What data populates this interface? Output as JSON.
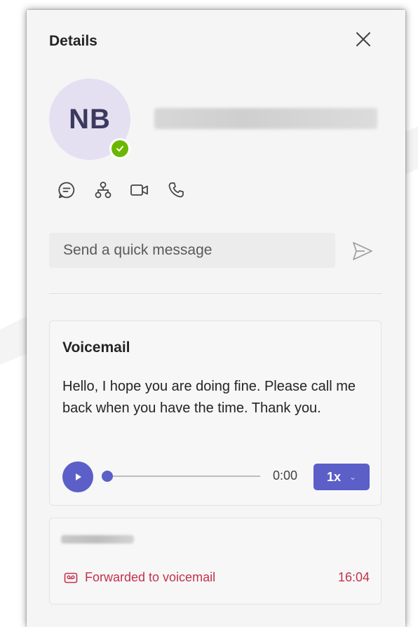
{
  "header": {
    "title": "Details",
    "close_icon": "close-icon"
  },
  "contact": {
    "initials": "NB",
    "presence_color": "#6bb700",
    "presence_icon": "check-icon"
  },
  "actions": [
    {
      "icon": "chat-icon"
    },
    {
      "icon": "org-chart-icon"
    },
    {
      "icon": "video-call-icon"
    },
    {
      "icon": "phone-icon"
    }
  ],
  "quick_message": {
    "placeholder": "Send a quick message",
    "value": "",
    "send_icon": "send-icon"
  },
  "voicemail": {
    "title": "Voicemail",
    "transcript": "Hello, I hope you are doing fine. Please call me back when you have the time. Thank you.",
    "time": "0:00",
    "progress": 0,
    "speed": "1x",
    "accent_color": "#5b5fc7"
  },
  "call_entry": {
    "status": "Forwarded to voicemail",
    "time": "16:04",
    "status_color": "#c4314b",
    "status_icon": "voicemail-icon"
  }
}
